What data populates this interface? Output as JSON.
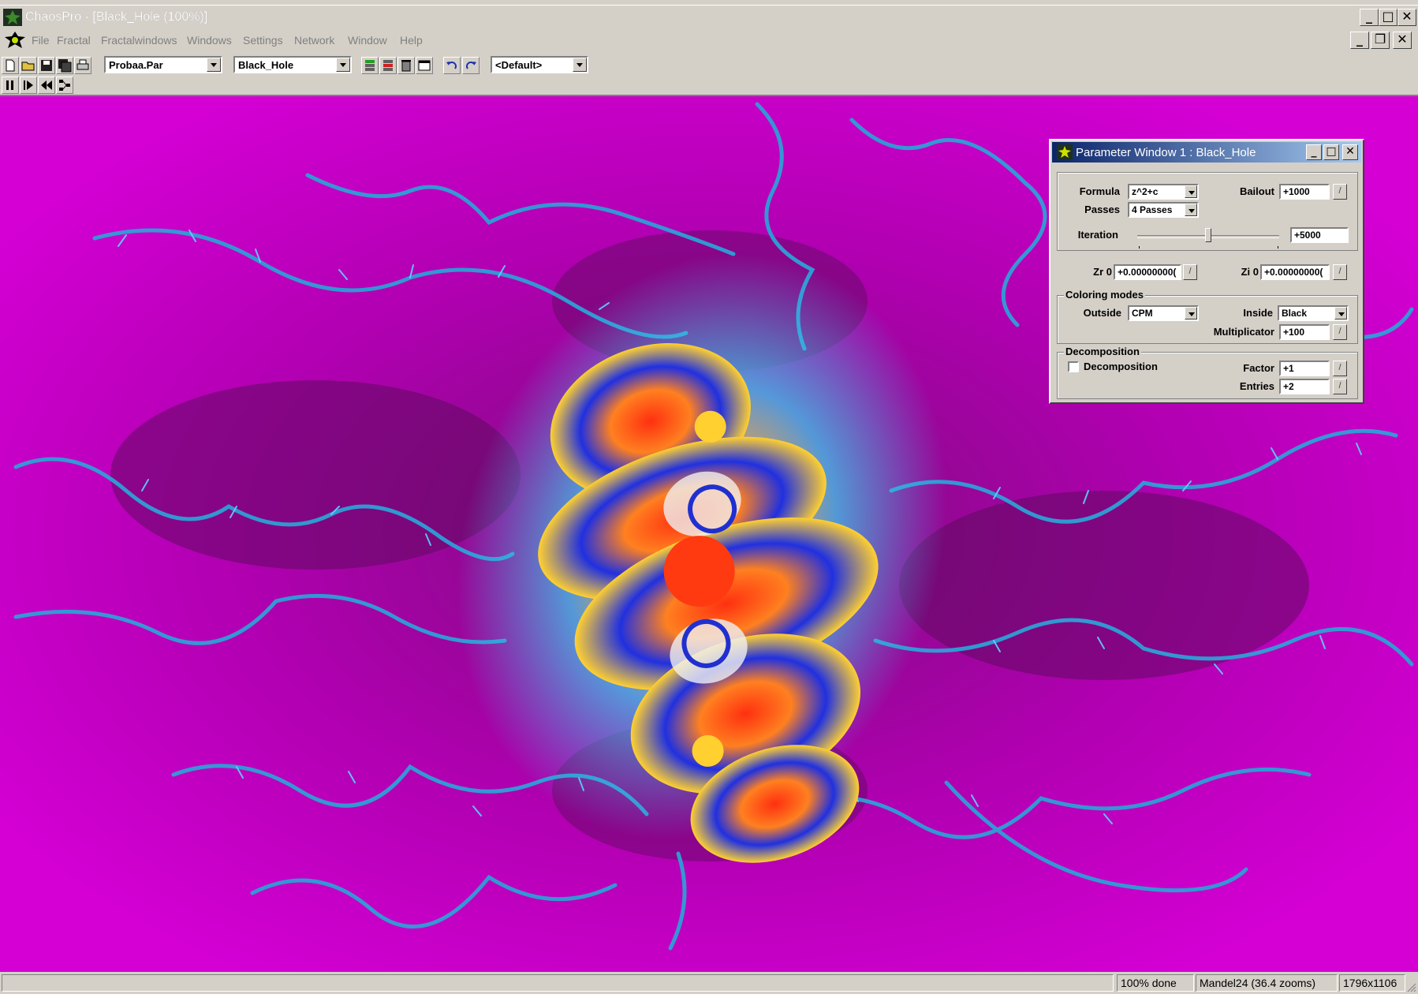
{
  "window": {
    "title": "ChaosPro - [Black_Hole (100%)]"
  },
  "menu": [
    "File",
    "Fractal",
    "Fractalwindows",
    "Windows",
    "Settings",
    "Network",
    "Window",
    "Help"
  ],
  "toolbar": {
    "parameter_file": "Probaa.Par",
    "parameter_set": "Black_Hole",
    "layer_set": "<Default>"
  },
  "param_window": {
    "title": "Parameter Window 1 : Black_Hole",
    "formula_label": "Formula",
    "formula_value": "z^2+c",
    "passes_label": "Passes",
    "passes_value": "4 Passes",
    "bailout_label": "Bailout",
    "bailout_value": "+1000",
    "iteration_label": "Iteration",
    "iteration_value": "+5000",
    "iteration_slider_fraction": 0.5,
    "zr_label": "Zr 0",
    "zr_value": "+0.00000000(",
    "zi_label": "Zi 0",
    "zi_value": "+0.00000000(",
    "coloring_title": "Coloring modes",
    "outside_label": "Outside",
    "outside_value": "CPM",
    "inside_label": "Inside",
    "inside_value": "Black",
    "multiplicator_label": "Multiplicator",
    "multiplicator_value": "+100",
    "decomp_title": "Decomposition",
    "decomp_checkbox_label": "Decomposition",
    "decomp_checked": false,
    "factor_label": "Factor",
    "factor_value": "+1",
    "entries_label": "Entries",
    "entries_value": "+2"
  },
  "status": {
    "progress": "100% done",
    "formula_info": "Mandel24 (36.4 zooms)",
    "resolution": "1796x1106"
  },
  "colors": {
    "background_magenta": "#cc00cc",
    "dark_purple": "#660066",
    "filament_cyan": "#33aadd",
    "titlebar_active": "#0a246a"
  }
}
